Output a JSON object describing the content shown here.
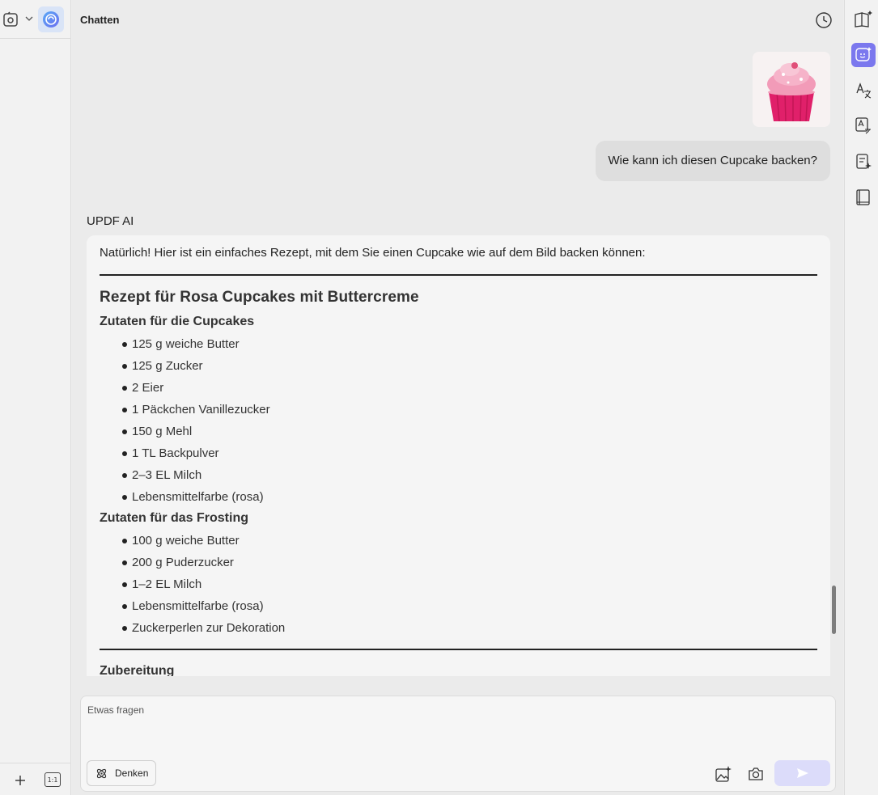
{
  "left_strip": {
    "mode_icon": "document-mode-icon",
    "ai_tab_icon": "updf-ai-icon",
    "add_icon": "plus-icon",
    "ratio_label": "1:1"
  },
  "chat": {
    "title": "Chatten",
    "history_icon": "history-clock-icon",
    "user_image_desc": "cupcake-image",
    "user_message": "Wie kann ich diesen Cupcake backen?",
    "ai_name": "UPDF AI",
    "intro": "Natürlich! Hier ist ein einfaches Rezept, mit dem Sie einen Cupcake wie auf dem Bild backen können:",
    "recipe_title": "Rezept für Rosa Cupcakes mit Buttercreme",
    "section1_title": "Zutaten für die Cupcakes",
    "section1_items": [
      "125 g weiche Butter",
      "125 g Zucker",
      "2 Eier",
      "1 Päckchen Vanillezucker",
      "150 g Mehl",
      "1 TL Backpulver",
      "2–3 EL Milch",
      "Lebensmittelfarbe (rosa)"
    ],
    "section2_title": "Zutaten für das Frosting",
    "section2_items": [
      "100 g weiche Butter",
      "200 g Puderzucker",
      "1–2 EL Milch",
      "Lebensmittelfarbe (rosa)",
      "Zuckerperlen zur Dekoration"
    ],
    "section3_title": "Zubereitung"
  },
  "composer": {
    "placeholder": "Etwas fragen",
    "think_label": "Denken",
    "think_icon": "atom-icon",
    "image_ai_icon": "image-sparkle-icon",
    "screenshot_icon": "camera-icon",
    "send_icon": "send-icon"
  },
  "right_strip": {
    "tools": [
      "book-sparkle-icon",
      "ai-chat-icon",
      "translate-icon",
      "text-translate-icon",
      "summary-icon",
      "book-icon"
    ],
    "active_tool": "ai-chat-icon",
    "active_color": "#7b78ee"
  }
}
